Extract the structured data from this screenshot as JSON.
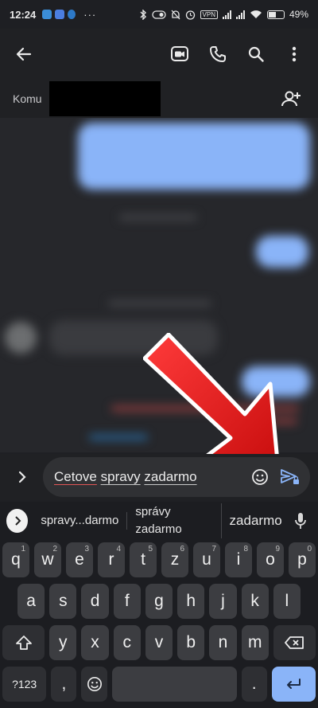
{
  "status_bar": {
    "time": "12:24",
    "more": "···",
    "vpn": "VPN",
    "battery": "49"
  },
  "recipient": {
    "label": "Komu"
  },
  "compose": {
    "word1": "Cetove",
    "word2": "spravy",
    "word3": "zadarmo"
  },
  "suggestions": {
    "items": [
      "spravy...darmo",
      "správy zadarmo",
      "zadarmo"
    ]
  },
  "keyboard": {
    "row1": [
      {
        "k": "q",
        "h": "1"
      },
      {
        "k": "w",
        "h": "2"
      },
      {
        "k": "e",
        "h": "3"
      },
      {
        "k": "r",
        "h": "4"
      },
      {
        "k": "t",
        "h": "5"
      },
      {
        "k": "z",
        "h": "6"
      },
      {
        "k": "u",
        "h": "7"
      },
      {
        "k": "i",
        "h": "8"
      },
      {
        "k": "o",
        "h": "9"
      },
      {
        "k": "p",
        "h": "0"
      }
    ],
    "row2": [
      "a",
      "s",
      "d",
      "f",
      "g",
      "h",
      "j",
      "k",
      "l"
    ],
    "row3": [
      "y",
      "x",
      "c",
      "v",
      "b",
      "n",
      "m"
    ],
    "symbols": "?123",
    "comma": ",",
    "period": "."
  },
  "colors": {
    "accent": "#8ab4f8",
    "background": "#202124",
    "arrow": "#e52525"
  }
}
